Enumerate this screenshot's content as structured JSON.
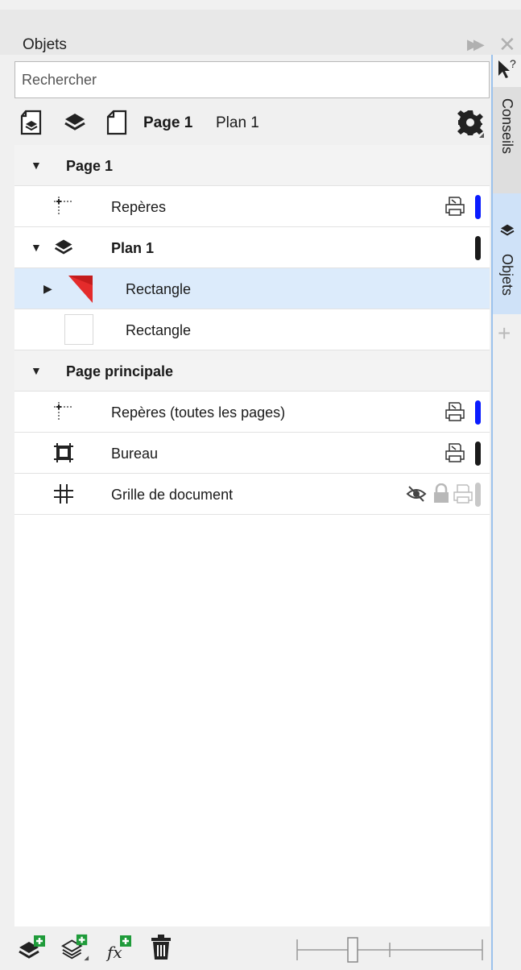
{
  "panel": {
    "title": "Objets",
    "expand_icon": "double-chevron-right-icon",
    "close_icon": "close-icon"
  },
  "search": {
    "placeholder": "Rechercher"
  },
  "toolbar": {
    "buttons": [
      "page-view-icon",
      "layers-icon",
      "page-icon"
    ],
    "current_page": "Page 1",
    "current_layer": "Plan 1",
    "settings_icon": "gear-icon"
  },
  "tree": {
    "page1": {
      "label": "Page 1",
      "expanded": true
    },
    "reperes": {
      "label": "Repères",
      "color": "#0a1cff"
    },
    "plan1": {
      "label": "Plan 1",
      "color": "#1a1a1a",
      "expanded": true
    },
    "rect1": {
      "label": "Rectangle",
      "fill": "#e42b2b",
      "selected": true,
      "collapsed": true
    },
    "rect2": {
      "label": "Rectangle",
      "fill": "#ffffff"
    },
    "master": {
      "label": "Page principale",
      "expanded": true
    },
    "reperes_all": {
      "label": "Repères (toutes les pages)",
      "color": "#0a1cff"
    },
    "bureau": {
      "label": "Bureau",
      "color": "#1a1a1a"
    },
    "grille": {
      "label": "Grille de document",
      "color": "#c8c8c8",
      "hidden": true,
      "locked": true
    }
  },
  "bottom_toolbar": {
    "buttons": [
      "new-layer-icon",
      "new-master-layer-icon",
      "new-effect-icon",
      "delete-icon"
    ]
  },
  "side_tabs": {
    "help_icon": "help-cursor-icon",
    "conseils": "Conseils",
    "objets": "Objets",
    "add_icon": "plus-icon"
  }
}
